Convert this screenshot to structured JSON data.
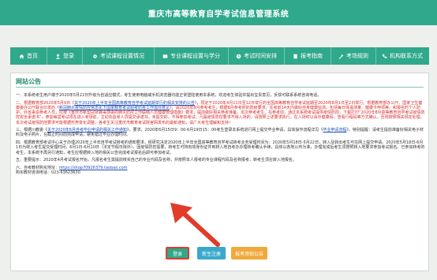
{
  "header": {
    "title": "重庆市高等教育自学考试信息管理系统"
  },
  "nav": {
    "items": [
      {
        "label": "首页",
        "icon": "home-icon"
      },
      {
        "label": "登录",
        "icon": "user-icon"
      },
      {
        "label": "考试课程设置情况",
        "icon": "gear-icon"
      },
      {
        "label": "专业课程设置与学分",
        "icon": "book-icon"
      },
      {
        "label": "考试时间安排",
        "icon": "clock-icon"
      },
      {
        "label": "报考指南",
        "icon": "guide-icon"
      },
      {
        "label": "考场规则",
        "icon": "rules-icon"
      },
      {
        "label": "机构联系方式",
        "icon": "phone-icon"
      }
    ]
  },
  "announcement": {
    "title": "网站公告",
    "p1": "一、本系统考生用户端于2020年5月22日升级为自适应模式，考生使用电脑或手机浏览器均能正常登陆使用本系统，欢迎考生体验并提出宝贵意见，反馈可联系系统咨询电话。",
    "p2_a": "二、根据教育部2020年5月9日《",
    "p2_link1": "关于2020年上半年全国高等教育自学考试延期举行的相关安排的公告",
    "p2_b": "》，原定于2020年4月11日至12日举行的全国高等教育自学考试延期至2020年8月1日至2日举行。根据教育部办公厅、国家卫生健康委办公厅联合印发的《",
    "p2_link2": "新冠肺炎疫情防控常态化下国家教育考试组考防疫工作指导意见",
    "p2_c": "》，请2020年8月参考考生，根据8月参考时的防疫要求，在考前14天内做好自身健康监测，包括每日体温测量、健康卡申领等，和报名时个人防护。外省来渝参考人员，应按《重庆市新型冠状病毒感染的肺炎防控工作联络人员健康管理措施》要求，提前做好相关参考准备。本次参考考生，在参考前，通过本系统考试提供疫情防控，下载打印“2020年8月高等教育自学考试疫情防控安全承诺书”。参加每堂考试须在进入考场前，主动向监考人员提交承诺书，未提交的，不得参加考试。凡属疫情防控要求不得入场的，请按照上述要求执行，在入场时以出示健康码、查看行程码等方式确认，否则按照相关规定处理。本次考试疫情防控要求可能根据形势变化调整，各考生关注重庆市教育考试院官网发布的最新通知，请广大考生理解和支持！",
    "p3_a": "三、根据川教委《",
    "p3_link": "关于2020年6月自考毕业申请的相关工作通知",
    "p3_b": "》，要求，2020年6月15日9：00-6月19日15：00考生登录本系统进行网上提交毕业申请，具体操作流程详见《",
    "p3_link2": "毕业申请流程",
    "p3_c": "》。特别提醒：请考生提前准备好相关电子材料及电子照片，在截止时间前完成申请，避免错过毕业办理时间。",
    "p4": "四、根据教育部考试中心关于办理2020年上半年自学考试转考的通知要求，经研究决定2020年上半年全国高等教育自学考试转考业务受理时间为：2020年5月18日-5月22日，转入及转出考生可在网上提交申请。2020年5月18日-6月1日为转入考生提交受理时间，6月1日-6月10日（法定节假日除外）。因疫情防控需要，转考生可持有效身份证件到转入地自考办办理转考确认手续，具体以各地公布为准，办理完成后考生须按照转入地要求参加考试报名。已参加转考的考生，本系统不再另行通知，考生应根据转入地的相关公告完成考试报名后即可参加考试。",
    "p5": "五、重要提示：2020年4月考试报名开始，凡报名考生需提前核实自己的专业代码及名称，并按照本人报考的专业课程代码及名称报考，转考生须在转入地报名。",
    "p6_a": "六、自考教材购买地址：",
    "p6_link": "https://shop70926379.taobao.com",
    "p6_b": "购买教材咨询电话：023-63623630"
  },
  "buttons": {
    "login": "登录",
    "register": "新生注册",
    "notice": "报考须知公告"
  },
  "colors": {
    "brand": "#2fa88b",
    "highlight": "#e23b2a",
    "register": "#3aa8cc",
    "notice": "#f0a93b"
  }
}
